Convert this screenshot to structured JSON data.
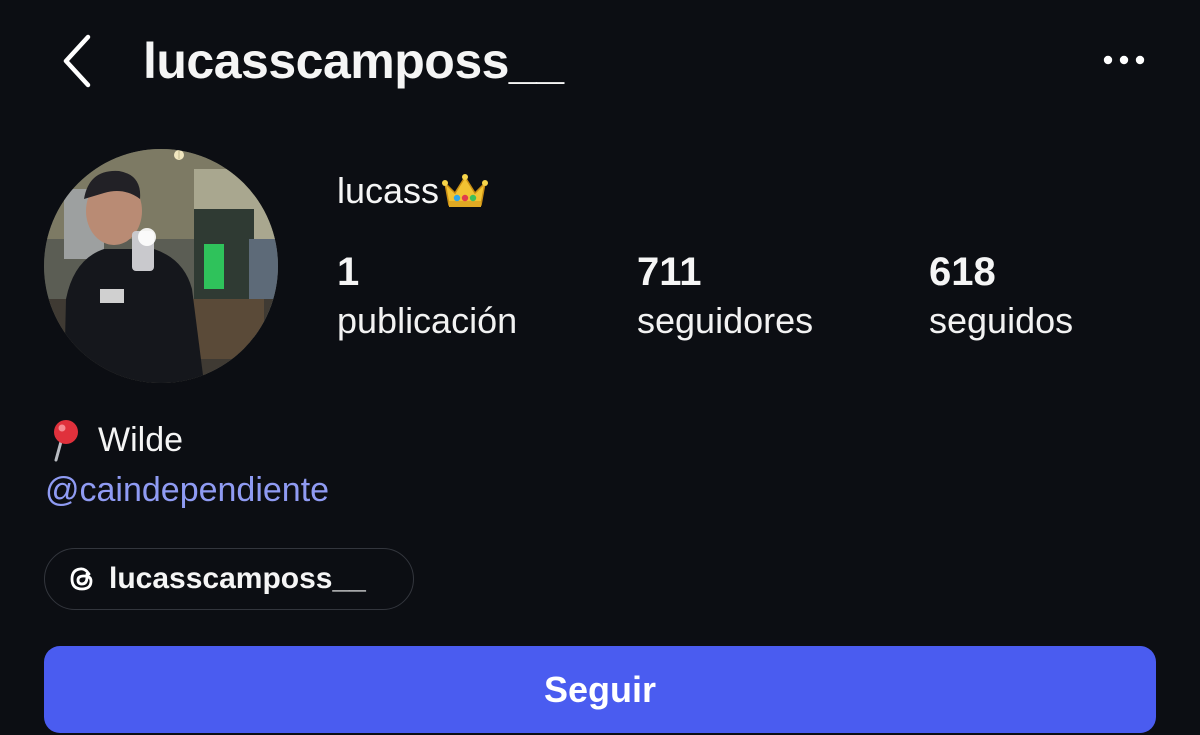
{
  "header": {
    "username": "lucasscamposs__",
    "back_icon": "chevron-left-icon",
    "more_icon": "ellipsis-icon"
  },
  "profile": {
    "display_name": "lucass",
    "name_emoji": "crown-icon"
  },
  "stats": {
    "posts": {
      "count": "1",
      "label": "publicación"
    },
    "followers": {
      "count": "711",
      "label": "seguidores"
    },
    "following": {
      "count": "618",
      "label": "seguidos"
    }
  },
  "bio": {
    "location_icon": "pin-icon",
    "location": "Wilde",
    "mention": "@caindependiente"
  },
  "threads": {
    "icon": "threads-icon",
    "handle": "lucasscamposs__"
  },
  "actions": {
    "follow_label": "Seguir"
  },
  "colors": {
    "background": "#0c0e13",
    "follow_button": "#4a5cf0",
    "mention_link": "#8f9bf3"
  }
}
